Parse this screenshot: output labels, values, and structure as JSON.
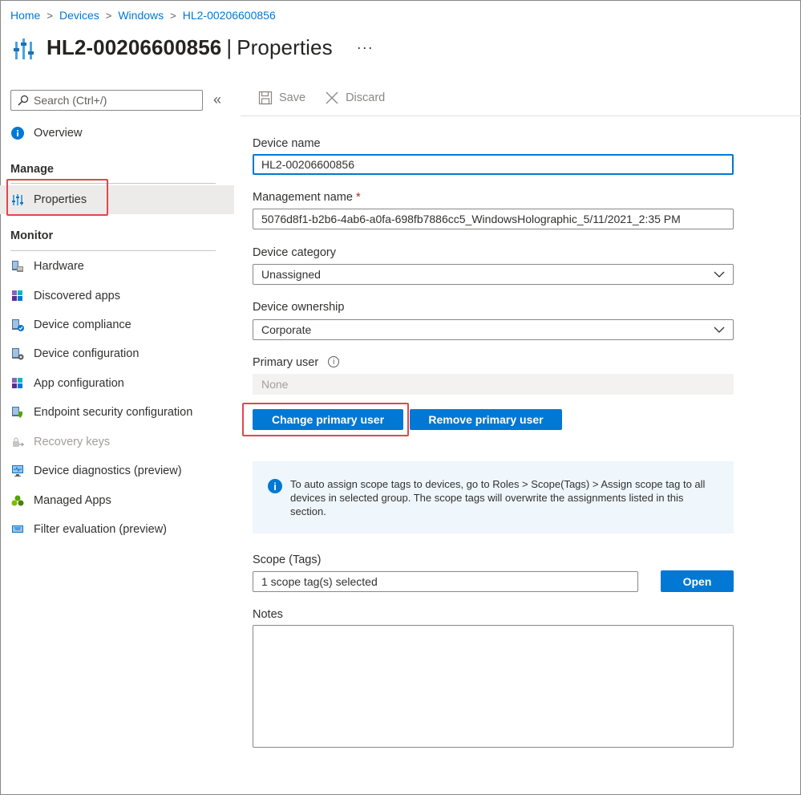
{
  "breadcrumb": {
    "items": [
      "Home",
      "Devices",
      "Windows",
      "HL2-00206600856"
    ],
    "separator": ">"
  },
  "header": {
    "title": "HL2-00206600856",
    "separator": "|",
    "subtitle": "Properties",
    "more": "···"
  },
  "sidebar": {
    "search_placeholder": "Search (Ctrl+/)",
    "collapse": "«",
    "overview": "Overview",
    "manage_heading": "Manage",
    "properties": "Properties",
    "monitor_heading": "Monitor",
    "monitor_items": [
      {
        "label": "Hardware",
        "icon": "hardware-icon"
      },
      {
        "label": "Discovered apps",
        "icon": "apps-grid-icon"
      },
      {
        "label": "Device compliance",
        "icon": "device-compliance-icon"
      },
      {
        "label": "Device configuration",
        "icon": "device-configuration-icon"
      },
      {
        "label": "App configuration",
        "icon": "app-configuration-icon"
      },
      {
        "label": "Endpoint security configuration",
        "icon": "endpoint-security-icon"
      },
      {
        "label": "Recovery keys",
        "icon": "key-icon"
      },
      {
        "label": "Device diagnostics (preview)",
        "icon": "diagnostics-icon"
      },
      {
        "label": "Managed Apps",
        "icon": "managed-apps-icon"
      },
      {
        "label": "Filter evaluation (preview)",
        "icon": "filter-evaluation-icon"
      }
    ]
  },
  "toolbar": {
    "save": "Save",
    "discard": "Discard"
  },
  "form": {
    "device_name_label": "Device name",
    "device_name_value": "HL2-00206600856",
    "management_name_label": "Management name",
    "required_mark": "*",
    "management_name_value": "5076d8f1-b2b6-4ab6-a0fa-698fb7886cc5_WindowsHolographic_5/11/2021_2:35 PM",
    "device_category_label": "Device category",
    "device_category_value": "Unassigned",
    "device_ownership_label": "Device ownership",
    "device_ownership_value": "Corporate",
    "primary_user_label": "Primary user",
    "primary_user_value": "None",
    "change_primary_user": "Change primary user",
    "remove_primary_user": "Remove primary user",
    "info_text": "To auto assign scope tags to devices, go to Roles > Scope(Tags) > Assign scope tag to all devices in selected group. The scope tags will overwrite the assignments listed in this section.",
    "scope_label": "Scope (Tags)",
    "scope_value": "1 scope tag(s) selected",
    "open_button": "Open",
    "notes_label": "Notes",
    "notes_value": ""
  },
  "colors": {
    "accent": "#0078d4",
    "highlight": "#e0474c",
    "info_bg": "#eff6fc"
  }
}
